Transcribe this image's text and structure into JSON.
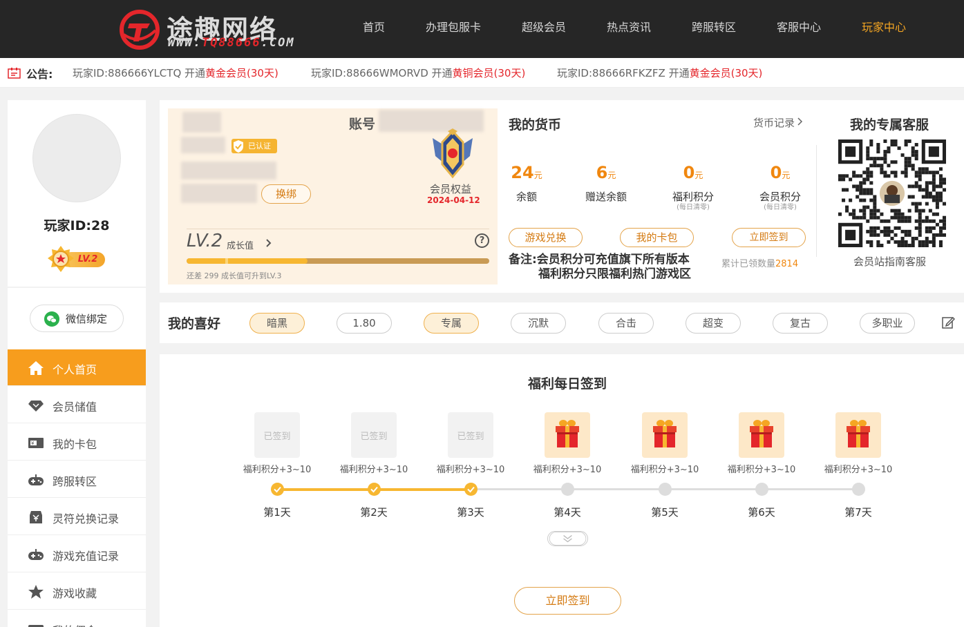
{
  "header": {
    "brand_name": "途趣网络",
    "brand_url_prefix": "WWW.",
    "brand_url_mid": "TQ88666",
    "brand_url_suffix": ".COM",
    "nav": [
      "首页",
      "办理包服卡",
      "超级会员",
      "热点资讯",
      "跨服转区",
      "客服中心",
      "玩家中心"
    ],
    "active_nav": "玩家中心"
  },
  "notice": {
    "label": "公告:",
    "items": [
      {
        "prefix": "玩家ID:886666YLCTQ 开通",
        "tier": "黄金会员(30天)"
      },
      {
        "prefix": "玩家ID:88666WMORVD 开通",
        "tier": "黄铜会员(30天)"
      },
      {
        "prefix": "玩家ID:88666RFKZFZ 开通",
        "tier": "黄金会员(30天)"
      }
    ]
  },
  "sidebar": {
    "player_id": "玩家ID:28",
    "level": "LV.2",
    "wechat_label": "微信绑定",
    "menu": [
      {
        "label": "个人首页",
        "icon": "home-icon",
        "active": true
      },
      {
        "label": "会员储值",
        "icon": "diamond-icon",
        "active": false
      },
      {
        "label": "我的卡包",
        "icon": "card-icon",
        "active": false
      },
      {
        "label": "跨服转区",
        "icon": "gamepad-icon",
        "active": false
      },
      {
        "label": "灵符兑换记录",
        "icon": "exchange-icon",
        "active": false
      },
      {
        "label": "游戏充值记录",
        "icon": "gamepad-icon",
        "active": false
      },
      {
        "label": "游戏收藏",
        "icon": "star-icon",
        "active": false
      },
      {
        "label": "我的佣金",
        "icon": "wallet-icon",
        "active": false
      }
    ]
  },
  "profile": {
    "verified_label": "已认证",
    "account_label": "账号",
    "rebind_label": "换绑",
    "rights_label": "会员权益",
    "rights_date": "2024-04-12",
    "level": "LV.2",
    "growth_label": "成长值",
    "help_symbol": "?",
    "progress_fraction": 0.4,
    "upgrade_tip": "还差 299 成长值可升到LV.3"
  },
  "currency": {
    "title": "我的货币",
    "record_link": "货币记录",
    "items": [
      {
        "value": "24",
        "unit": "元",
        "label": "余额",
        "sub": ""
      },
      {
        "value": "6",
        "unit": "元",
        "label": "赠送余额",
        "sub": ""
      },
      {
        "value": "0",
        "unit": "元",
        "label": "福利积分",
        "sub": "(每日清零)"
      },
      {
        "value": "0",
        "unit": "元",
        "label": "会员积分",
        "sub": "(每日清零)"
      }
    ],
    "buttons": [
      "游戏兑换",
      "我的卡包",
      "立即签到"
    ],
    "remark_line1": "备注:会员积分可充值旗下所有版本",
    "remark_line2": "福利积分只限福利热门游戏区",
    "signin_count_label": "累计已领数量",
    "signin_count_value": "2814"
  },
  "service": {
    "title": "我的专属客服",
    "subtitle": "会员站指南客服"
  },
  "preferences": {
    "title": "我的喜好",
    "tags": [
      {
        "label": "暗黑",
        "selected": true
      },
      {
        "label": "1.80",
        "selected": false
      },
      {
        "label": "专属",
        "selected": true
      },
      {
        "label": "沉默",
        "selected": false
      },
      {
        "label": "合击",
        "selected": false
      },
      {
        "label": "超变",
        "selected": false
      },
      {
        "label": "复古",
        "selected": false
      },
      {
        "label": "多职业",
        "selected": false
      }
    ]
  },
  "signin": {
    "title": "福利每日签到",
    "days": [
      {
        "label": "第1天",
        "reward": "福利积分+3~10",
        "status": "done",
        "status_text": "已签到"
      },
      {
        "label": "第2天",
        "reward": "福利积分+3~10",
        "status": "done",
        "status_text": "已签到"
      },
      {
        "label": "第3天",
        "reward": "福利积分+3~10",
        "status": "done",
        "status_text": "已签到"
      },
      {
        "label": "第4天",
        "reward": "福利积分+3~10",
        "status": "gift",
        "status_text": ""
      },
      {
        "label": "第5天",
        "reward": "福利积分+3~10",
        "status": "gift",
        "status_text": ""
      },
      {
        "label": "第6天",
        "reward": "福利积分+3~10",
        "status": "gift",
        "status_text": ""
      },
      {
        "label": "第7天",
        "reward": "福利积分+3~10",
        "status": "gift",
        "status_text": ""
      }
    ],
    "button_label": "立即签到"
  },
  "colors": {
    "accent": "#f79d1d",
    "highlight": "#e4262b",
    "topbar": "#262626"
  }
}
